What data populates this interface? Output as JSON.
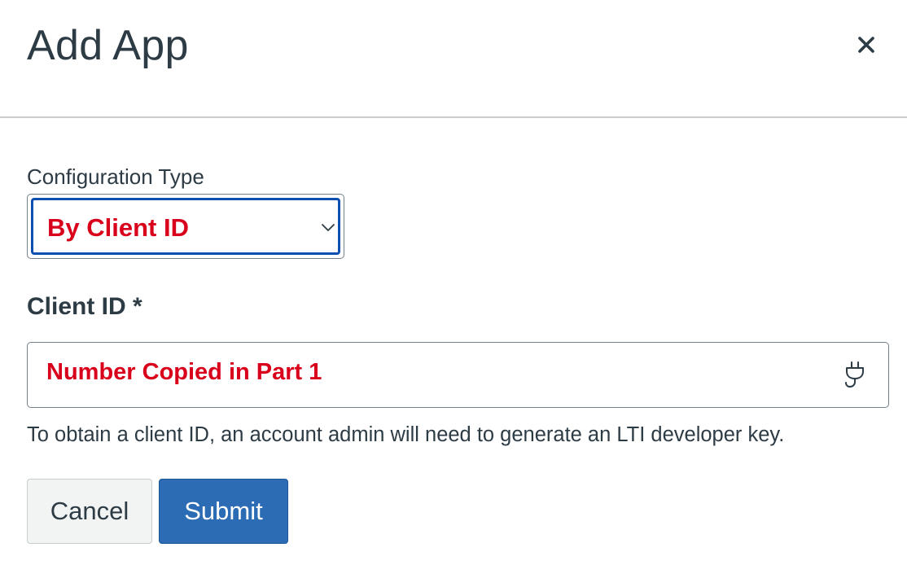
{
  "dialog": {
    "title": "Add App",
    "close_icon": "close-icon"
  },
  "form": {
    "config_type_label": "Configuration Type",
    "config_type_value": "By Client ID",
    "client_id_label": "Client ID *",
    "client_id_value": "Number Copied in Part 1",
    "client_id_icon": "plug-icon",
    "help_text": "To obtain a client ID, an account admin will need to generate an LTI developer key."
  },
  "buttons": {
    "cancel_label": "Cancel",
    "submit_label": "Submit"
  },
  "colors": {
    "accent": "#0b4fb3",
    "annotation_red": "#d9001b",
    "submit_bg": "#2b6cb5",
    "text": "#2d3b45"
  }
}
